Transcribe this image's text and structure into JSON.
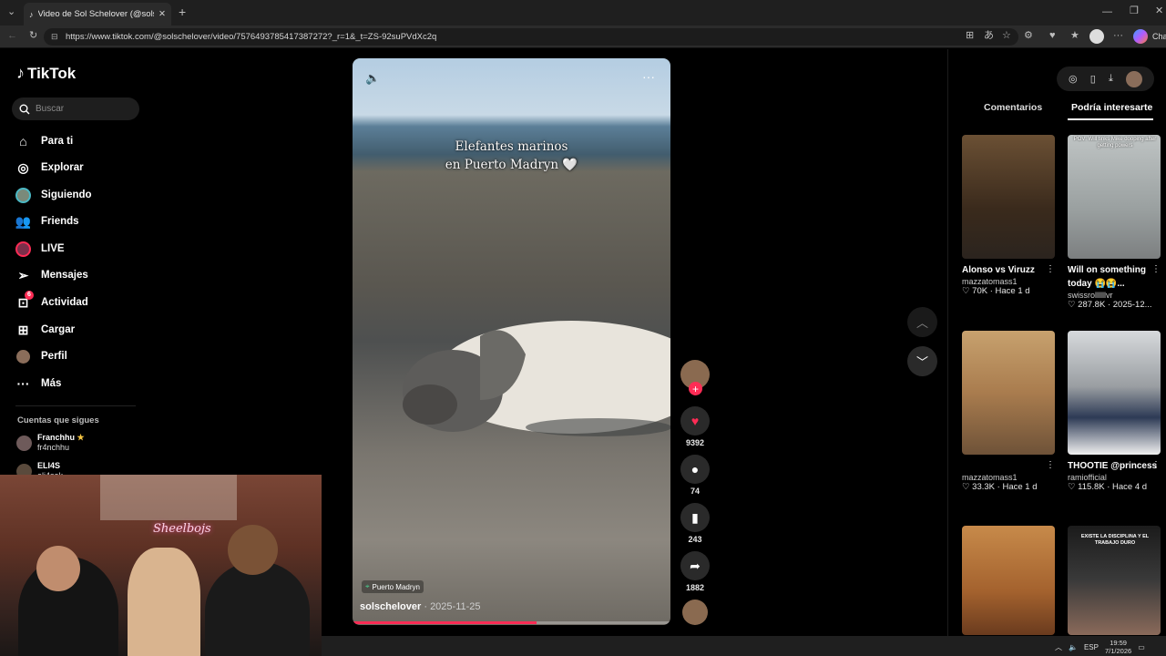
{
  "browser": {
    "tab_title": "Video de Sol Schelover (@solsche",
    "url": "https://www.tiktok.com/@solschelover/video/7576493785417387272?_r=1&_t=ZS-92suPVdXc2q",
    "extension_label": "Cha"
  },
  "sidebar": {
    "logo": "TikTok",
    "search_placeholder": "Buscar",
    "nav": [
      {
        "label": "Para ti",
        "icon": "home-icon"
      },
      {
        "label": "Explorar",
        "icon": "compass-icon"
      },
      {
        "label": "Siguiendo",
        "icon": "following-avatar-icon"
      },
      {
        "label": "Friends",
        "icon": "friends-icon"
      },
      {
        "label": "LIVE",
        "icon": "live-icon"
      },
      {
        "label": "Mensajes",
        "icon": "messages-icon"
      },
      {
        "label": "Actividad",
        "icon": "activity-icon",
        "badge": "6"
      },
      {
        "label": "Cargar",
        "icon": "upload-icon"
      },
      {
        "label": "Perfil",
        "icon": "profile-icon"
      },
      {
        "label": "Más",
        "icon": "more-icon"
      }
    ],
    "follows_title": "Cuentas que sigues",
    "accounts": [
      {
        "name": "Franchhu",
        "handle": "fr4nchhu"
      },
      {
        "name": "ELI4S",
        "handle": "eli4sok"
      }
    ]
  },
  "webcam": {
    "neon_sign": "Sheelbojs"
  },
  "video": {
    "caption_line1": "Elefantes marinos",
    "caption_line2": "en Puerto Madryn 🤍",
    "location": "Puerto Madryn",
    "author": "solschelover",
    "date": "2025-11-25",
    "progress": 0.58
  },
  "actions": {
    "likes": "9392",
    "comments": "74",
    "saves": "243",
    "shares": "1882"
  },
  "right_panel": {
    "tabs": [
      "Comentarios",
      "Podría interesarte"
    ],
    "active_tab": "Podría interesarte",
    "cards": [
      {
        "title": "Alonso vs Viruzz",
        "user": "mazzatomass1",
        "likes": "70K",
        "time": "Hace 1 d",
        "thumb_text": ""
      },
      {
        "title": "Will on something today 😭😭...",
        "user": "swissrollllllvr",
        "likes": "287.8K",
        "time": "2025-12...",
        "thumb_text": "POV: Will tinks Mike dooping after getting powers"
      },
      {
        "title": "",
        "user": "mazzatomass1",
        "likes": "33.3K",
        "time": "Hace 1 d",
        "thumb_text": ""
      },
      {
        "title": "THOOTIE @princess",
        "user": "ramiofficial",
        "likes": "115.8K",
        "time": "Hace 4 d",
        "thumb_text": ""
      },
      {
        "title": "",
        "user": "",
        "likes": "",
        "time": "",
        "thumb_text": ""
      },
      {
        "title": "",
        "user": "",
        "likes": "",
        "time": "",
        "thumb_text": "EXISTE LA DISCIPLINA Y EL TRABAJO DURO"
      }
    ]
  },
  "taskbar": {
    "lang": "ESP",
    "time": "19:59",
    "date": "7/1/2026"
  }
}
